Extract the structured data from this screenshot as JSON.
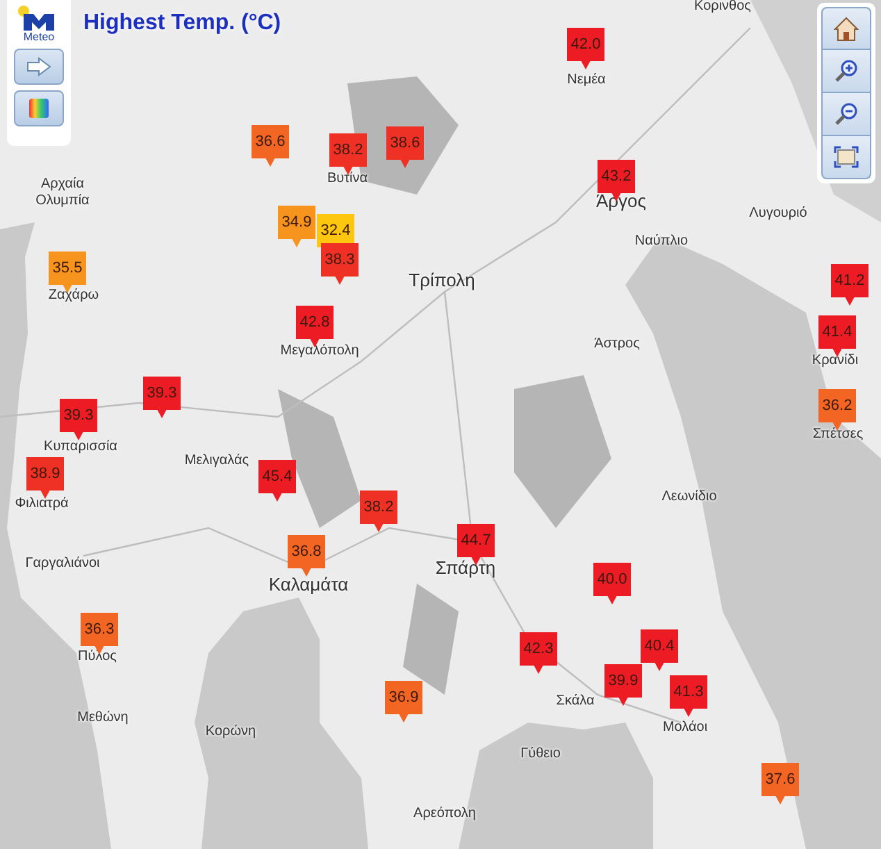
{
  "title": "Highest Temp. (°C)",
  "logo": {
    "text": "Meteo"
  },
  "places": [
    {
      "name": "Κορινθος"
    },
    {
      "name": "Νεμέα"
    },
    {
      "name": "Αρχαία Ολυμπία"
    },
    {
      "name": "Βυτίνα"
    },
    {
      "name": "Άργος"
    },
    {
      "name": "Λυγουριό"
    },
    {
      "name": "Ναύπλιο"
    },
    {
      "name": "Τρίπολη"
    },
    {
      "name": "Ζαχάρω"
    },
    {
      "name": "Μεγαλόπολη"
    },
    {
      "name": "Άστρος"
    },
    {
      "name": "Κρανίδι"
    },
    {
      "name": "Κυπαρισσία"
    },
    {
      "name": "Σπέτσες"
    },
    {
      "name": "Μελιγαλάς"
    },
    {
      "name": "Λεωνίδιο"
    },
    {
      "name": "Φιλιατρά"
    },
    {
      "name": "Σπάρτη"
    },
    {
      "name": "Γαργαλιάνοι"
    },
    {
      "name": "Καλαμάτα"
    },
    {
      "name": "Πύλος"
    },
    {
      "name": "Σκάλα"
    },
    {
      "name": "Μολάοι"
    },
    {
      "name": "Μεθώνη"
    },
    {
      "name": "Κορώνη"
    },
    {
      "name": "Γύθειο"
    },
    {
      "name": "Αρεόπολη"
    }
  ],
  "markers": [
    {
      "value": "36.6",
      "color": "#f26522"
    },
    {
      "value": "38.2",
      "color": "#ee3124"
    },
    {
      "value": "38.6",
      "color": "#ee3124"
    },
    {
      "value": "42.0",
      "color": "#ed1c24"
    },
    {
      "value": "43.2",
      "color": "#ed1c24"
    },
    {
      "value": "34.9",
      "color": "#f7941d"
    },
    {
      "value": "32.4",
      "color": "#fdc70f"
    },
    {
      "value": "38.3",
      "color": "#ee3124"
    },
    {
      "value": "35.5",
      "color": "#f7941d"
    },
    {
      "value": "41.2",
      "color": "#ed1c24"
    },
    {
      "value": "42.8",
      "color": "#ed1c24"
    },
    {
      "value": "41.4",
      "color": "#ed1c24"
    },
    {
      "value": "39.3",
      "color": "#ed1c24"
    },
    {
      "value": "39.3",
      "color": "#ed1c24"
    },
    {
      "value": "36.2",
      "color": "#f26522"
    },
    {
      "value": "38.9",
      "color": "#ee3124"
    },
    {
      "value": "45.4",
      "color": "#ed1c24"
    },
    {
      "value": "38.2",
      "color": "#ee3124"
    },
    {
      "value": "44.7",
      "color": "#ed1c24"
    },
    {
      "value": "36.8",
      "color": "#f26522"
    },
    {
      "value": "40.0",
      "color": "#ed1c24"
    },
    {
      "value": "36.3",
      "color": "#f26522"
    },
    {
      "value": "42.3",
      "color": "#ed1c24"
    },
    {
      "value": "40.4",
      "color": "#ed1c24"
    },
    {
      "value": "39.9",
      "color": "#ed1c24"
    },
    {
      "value": "41.3",
      "color": "#ed1c24"
    },
    {
      "value": "36.9",
      "color": "#f26522"
    },
    {
      "value": "37.6",
      "color": "#f26522"
    }
  ]
}
